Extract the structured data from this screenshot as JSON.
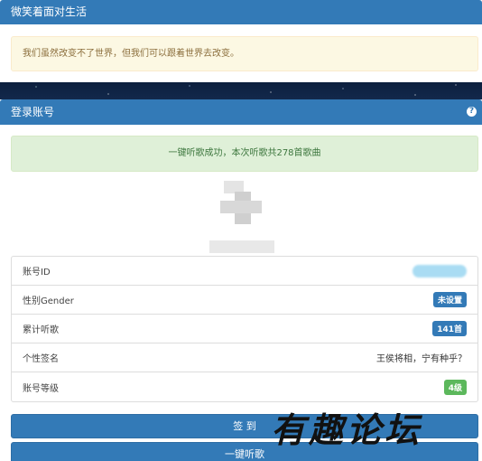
{
  "top_panel": {
    "title": "微笑着面对生活",
    "message": "我们虽然改变不了世界，但我们可以跟着世界去改变。"
  },
  "login_panel": {
    "title": "登录账号",
    "help_icon": "question-circle-icon",
    "success_message": "一键听歌成功，本次听歌共278首歌曲",
    "rows": [
      {
        "label": "账号ID",
        "value": "",
        "type": "badge-blurred"
      },
      {
        "label": "性别Gender",
        "value": "未设置",
        "type": "badge"
      },
      {
        "label": "累计听歌",
        "value": "141首",
        "type": "badge"
      },
      {
        "label": "个性签名",
        "value": "王侯将相，宁有种乎？",
        "type": "text"
      },
      {
        "label": "账号等级",
        "value": "4级",
        "type": "badge-green"
      }
    ],
    "signin_button": "签 到",
    "listen_button": "一键听歌"
  },
  "watermark": "有趣论坛",
  "colors": {
    "primary": "#337ab7",
    "success_bg": "#dff0d8",
    "warning_bg": "#fcf8e3",
    "badge_green": "#5cb85c"
  }
}
